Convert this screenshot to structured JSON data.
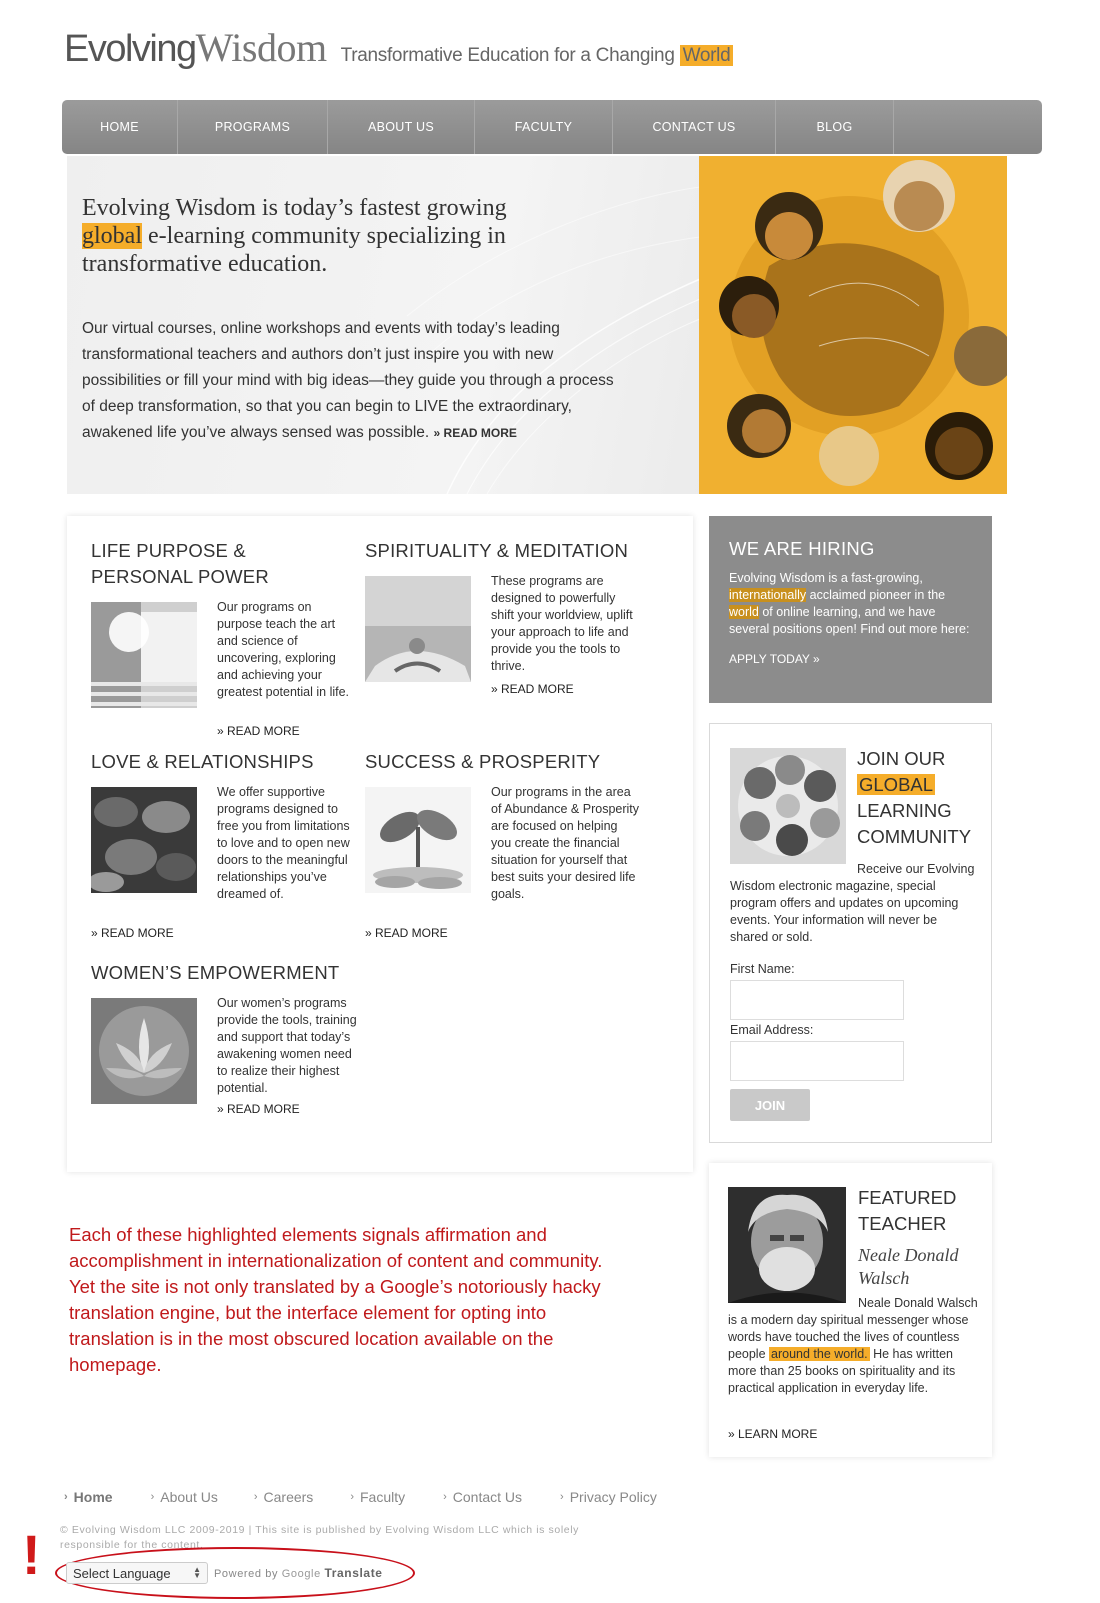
{
  "header": {
    "logo_part1": "Evolving",
    "logo_part2": "Wisdom",
    "tagline": "Transformative Education for a Changing",
    "tagline_highlight": "World"
  },
  "nav": {
    "items": [
      {
        "label": "HOME"
      },
      {
        "label": "PROGRAMS"
      },
      {
        "label": "ABOUT US"
      },
      {
        "label": "FACULTY"
      },
      {
        "label": "CONTACT US"
      },
      {
        "label": "BLOG"
      }
    ]
  },
  "hero": {
    "heading_pre": "Evolving Wisdom is today’s fastest growing",
    "heading_highlight": "global",
    "heading_post": "e-learning community specializing in transformative education.",
    "body": "Our virtual courses, online workshops and events with today’s leading transformational teachers and authors don’t just inspire you with new possibilities or fill your mind with big ideas—they guide you through a process of deep transformation, so that you can begin to LIVE the extraordinary, awakened life you’ve always sensed was possible.",
    "read_more": "» READ MORE"
  },
  "programs": [
    {
      "title": "LIFE PURPOSE & PERSONAL POWER",
      "desc": "Our programs on purpose teach the art and science of uncovering, exploring and achieving your greatest potential in life.",
      "link": "» READ MORE"
    },
    {
      "title": "SPIRITUALITY & MEDITATION",
      "desc": "These programs are designed to powerfully shift your worldview, uplift your approach to life and provide you the tools to thrive.",
      "link": "» READ MORE"
    },
    {
      "title": "LOVE & RELATIONSHIPS",
      "desc": "We offer supportive programs designed to free you from limitations to love and to open new doors to the meaningful relationships you’ve dreamed of.",
      "link": "» READ MORE"
    },
    {
      "title": "SUCCESS & PROSPERITY",
      "desc": "Our programs in the area of Abundance & Prosperity are focused on helping you create the financial situation for yourself that best suits your desired life goals.",
      "link": "» READ MORE"
    },
    {
      "title": "WOMEN’S EMPOWERMENT",
      "desc": "Our women’s programs provide the tools, training and support that today’s awakening women need to realize their highest potential.",
      "link": "» READ MORE"
    }
  ],
  "hiring": {
    "title": "WE ARE HIRING",
    "text_pre": "Evolving Wisdom is a fast-growing,",
    "highlight1": "internationally",
    "text_mid": "acclaimed pioneer in the",
    "highlight2": "world",
    "text_post": "of online learning, and we have several positions open! Find out more here:",
    "link": "APPLY TODAY »"
  },
  "join": {
    "title_pre": "JOIN OUR",
    "title_highlight": "GLOBAL",
    "title_post": "LEARNING COMMUNITY",
    "text": "Receive our Evolving Wisdom electronic magazine, special program offers and updates on upcoming events. Your information will never be shared or sold.",
    "first_name_label": "First Name:",
    "first_name_value": "",
    "email_label": "Email Address:",
    "email_value": "",
    "button": "JOIN"
  },
  "teacher": {
    "title": "FEATURED TEACHER",
    "name": "Neale Donald Walsch",
    "text_pre": "Neale Donald Walsch is a modern day spiritual messenger whose words have touched the lives of countless people",
    "highlight": "around the world.",
    "text_post": "He has written more than 25 books on spirituality and its practical application in everyday life.",
    "link": "» LEARN MORE"
  },
  "annotation": "Each of these highlighted elements signals affirmation and accomplishment in internationalization of content and community. Yet the site is not only translated by a Google’s notoriously hacky translation engine, but the interface element for opting into translation is in the most obscured location available on the homepage.",
  "footer": {
    "links": [
      {
        "label": "Home"
      },
      {
        "label": "About Us"
      },
      {
        "label": "Careers"
      },
      {
        "label": "Faculty"
      },
      {
        "label": "Contact Us"
      },
      {
        "label": "Privacy Policy"
      }
    ],
    "copyright": "© Evolving Wisdom LLC 2009-2019 | This site is published by Evolving Wisdom LLC which is solely responsible for the content.",
    "exclamation": "!",
    "language_select": "Select Language",
    "powered_by": "Powered by",
    "google": "Google",
    "translate": "Translate"
  },
  "colors": {
    "highlight": "#f5ad2a",
    "nav_bg": "#8f8f8f",
    "annotation_red": "#c0191b",
    "hiring_bg": "#8c8c8c"
  },
  "icons": {
    "footer_chevron": "chevron-right-icon",
    "select_arrows": "up-down-arrows-icon"
  }
}
